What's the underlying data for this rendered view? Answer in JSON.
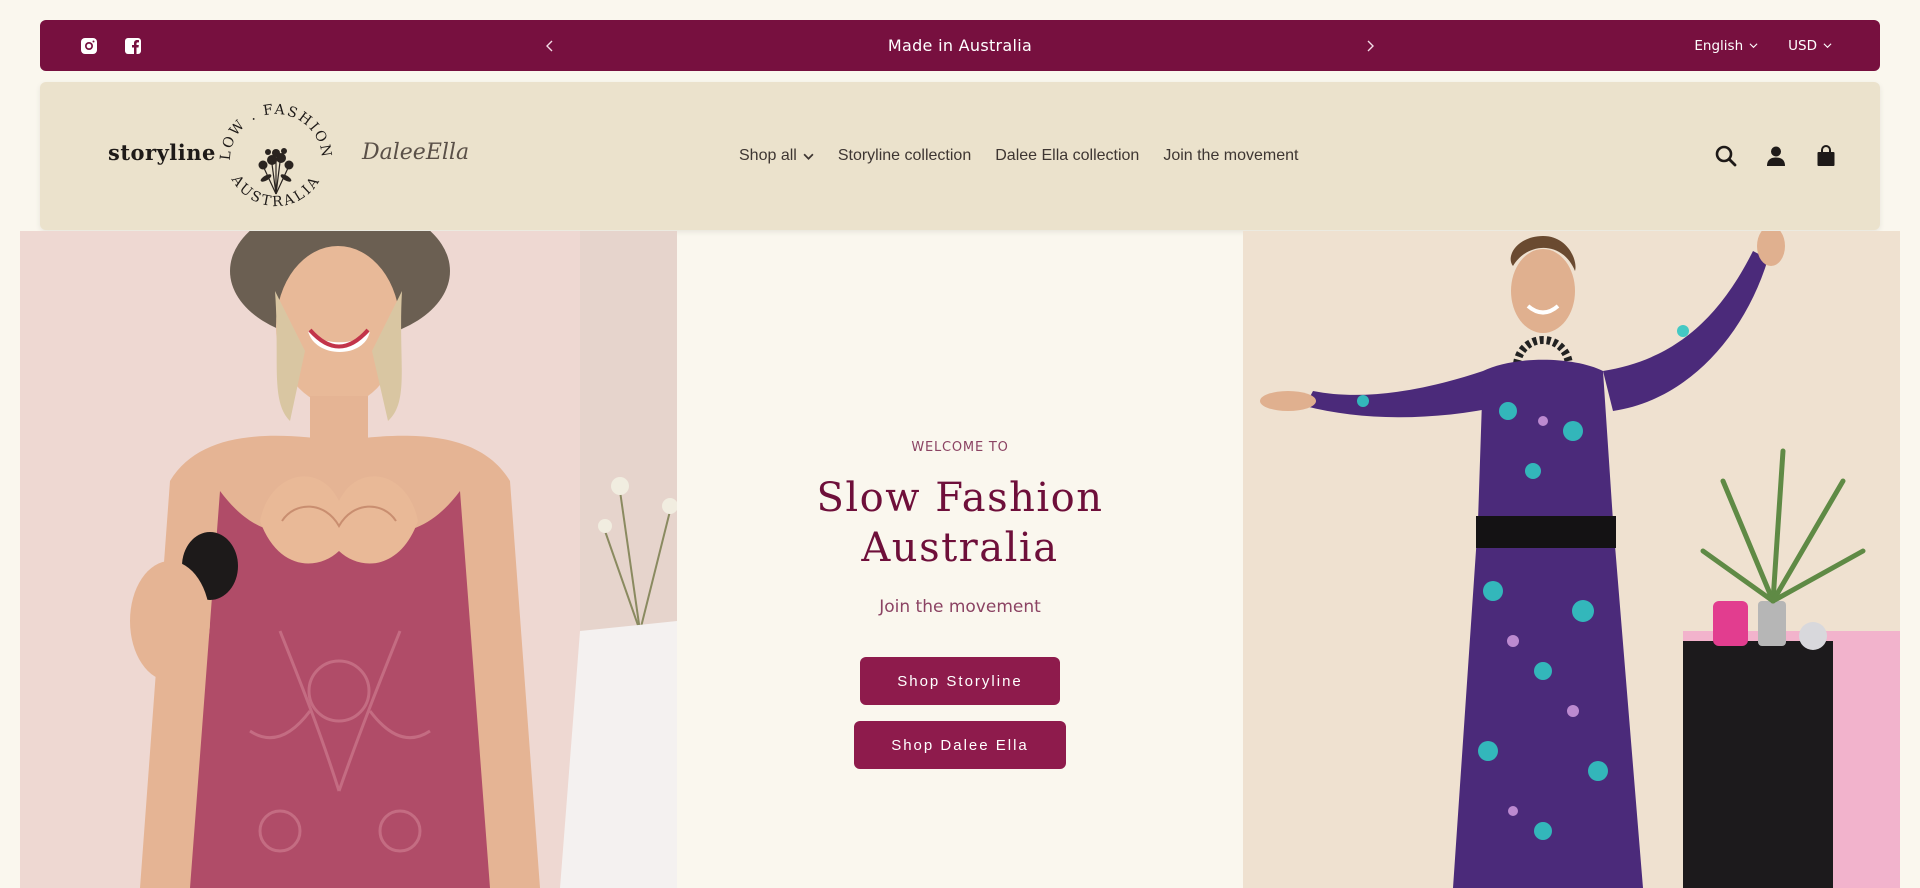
{
  "announcement": {
    "text": "Made in Australia",
    "prev_icon": "chevron-left-icon",
    "next_icon": "chevron-right-icon",
    "social": [
      "instagram-icon",
      "facebook-icon"
    ],
    "language": "English",
    "currency": "USD"
  },
  "header": {
    "brand_left": "storyline",
    "seal_text": "SLOW . FASHION . AUSTRALIA",
    "brand_right": "DaleeElla",
    "nav": [
      {
        "label": "Shop all",
        "has_dropdown": true
      },
      {
        "label": "Storyline collection"
      },
      {
        "label": "Dalee Ella collection"
      },
      {
        "label": "Join the movement"
      }
    ],
    "icons": [
      "search-icon",
      "account-icon",
      "cart-icon"
    ]
  },
  "hero": {
    "eyebrow": "WELCOME TO",
    "title": "Slow Fashion Australia",
    "subtitle": "Join the movement",
    "button_primary": "Shop Storyline",
    "button_secondary": "Shop Dalee Ella"
  },
  "colors": {
    "brand_maroon": "#77103f",
    "button": "#8e1b4c",
    "header_bg": "#ebe2cc",
    "page_bg": "#faf7ee"
  }
}
